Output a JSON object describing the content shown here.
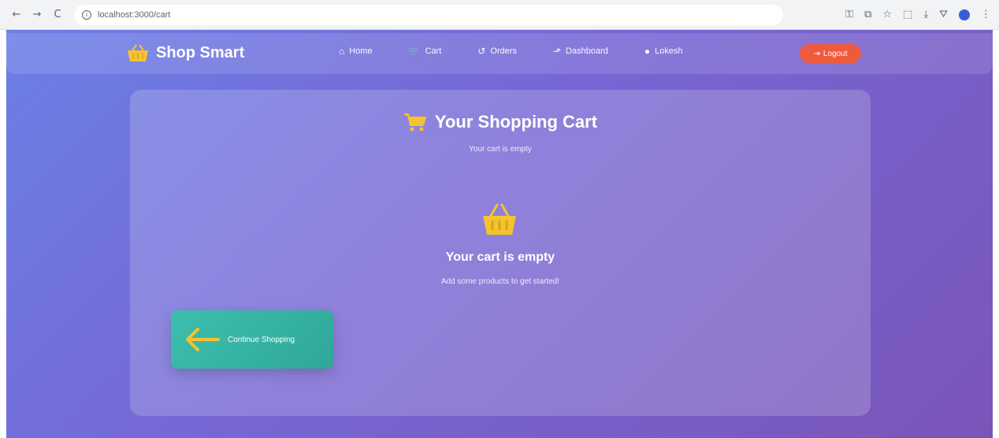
{
  "browser": {
    "url": "localhost:3000/cart",
    "back_label": "←",
    "forward_label": "→",
    "reload_label": "C",
    "info_label": "i"
  },
  "navbar": {
    "brand": "Shop Smart",
    "links": [
      {
        "label": "Home",
        "icon": "home-icon",
        "glyph": "⌂"
      },
      {
        "label": "Cart",
        "icon": "cart-icon",
        "glyph": "🛒"
      },
      {
        "label": "Orders",
        "icon": "history-icon",
        "glyph": "↺"
      },
      {
        "label": "Dashboard",
        "icon": "chart-icon",
        "glyph": "⬏"
      },
      {
        "label": "Lokesh",
        "icon": "user-icon",
        "glyph": "●"
      }
    ],
    "logout_label": "Logout",
    "logout_color": "#ef5a3c"
  },
  "cart": {
    "title": "Your Shopping Cart",
    "subtitle": "Your cart is empty",
    "empty_title": "Your cart is empty",
    "empty_subtitle": "Add some products to get started!",
    "continue_label": "Continue Shopping"
  },
  "colors": {
    "accent_yellow": "#f4c430",
    "button_teal": "#3dbfae",
    "background_start": "#6b7fe6",
    "background_end": "#7a55b8"
  }
}
